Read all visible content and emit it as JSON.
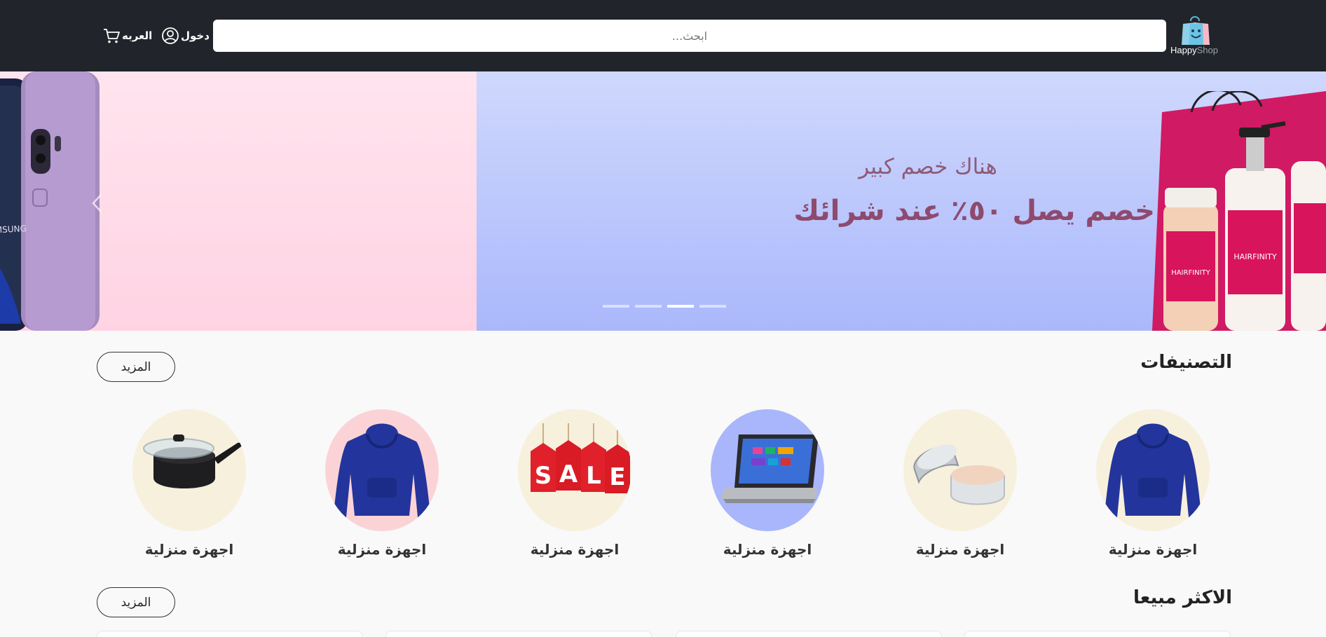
{
  "header": {
    "logo": {
      "brand_happy": "Happy",
      "brand_shop": "Shop",
      "icon": "shopping-bag-logo"
    },
    "search": {
      "placeholder": "ابحث..."
    },
    "login_label": "دخول",
    "login_icon": "user-circle-icon",
    "cart_label": "العربه",
    "cart_icon": "cart-icon",
    "background_color": "#21252b"
  },
  "hero": {
    "subtitle": "هناك خصم كبير",
    "headline": "خصم يصل ٥٠٪ عند شرائك",
    "slide_count": 4,
    "active_slide_index": 3,
    "colors": {
      "left_slide": "#ffd9e6",
      "right_slide": "#bcc8fc",
      "text": "#8e4a6e"
    }
  },
  "categories": {
    "title": "التصنيفات",
    "more_label": "المزيد",
    "items": [
      {
        "label": "اجهزة منزلية",
        "image": "hoodie",
        "bg": "#f7f0dd"
      },
      {
        "label": "اجهزة منزلية",
        "image": "cream-jar",
        "bg": "#f7f0dd"
      },
      {
        "label": "اجهزة منزلية",
        "image": "laptop",
        "bg": "#a9b6fb"
      },
      {
        "label": "اجهزة منزلية",
        "image": "sale-tags",
        "bg": "#f7f0dd"
      },
      {
        "label": "اجهزة منزلية",
        "image": "hoodie",
        "bg": "#fbd3d6"
      },
      {
        "label": "اجهزة منزلية",
        "image": "cooking-pot",
        "bg": "#f7f0dd"
      }
    ]
  },
  "best_sellers": {
    "title": "الاكثر مبيعا",
    "more_label": "المزيد"
  }
}
